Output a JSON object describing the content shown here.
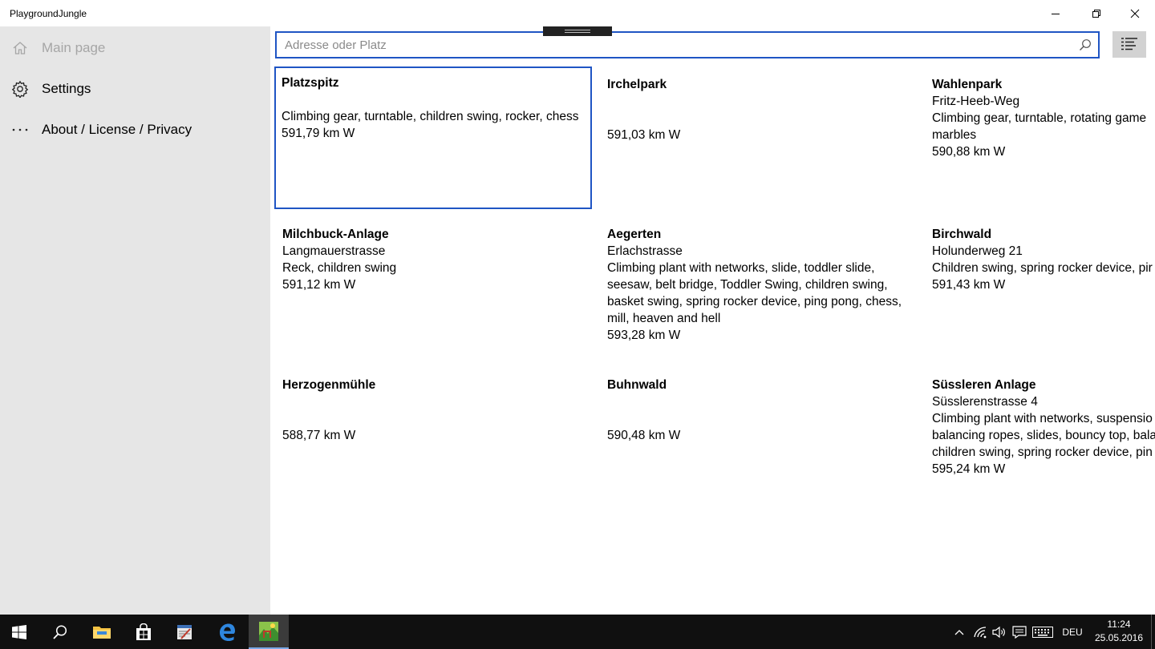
{
  "window": {
    "title": "PlaygroundJungle"
  },
  "nav": {
    "items": [
      {
        "label": "Main page",
        "icon": "home-icon",
        "enabled": false
      },
      {
        "label": "Settings",
        "icon": "gear-icon",
        "enabled": true
      },
      {
        "label": "About / License / Privacy",
        "icon": "more-icon",
        "enabled": true
      }
    ]
  },
  "search": {
    "placeholder": "Adresse oder Platz",
    "value": ""
  },
  "playgrounds": [
    {
      "name": "Platzspitz",
      "address": "",
      "equipment": "Climbing gear, turntable, children swing, rocker, chess",
      "distance": "591,79 km W",
      "selected": true
    },
    {
      "name": "Irchelpark",
      "address": "",
      "equipment": "",
      "distance": "591,03 km W"
    },
    {
      "name": "Wahlenpark",
      "address": "Fritz-Heeb-Weg",
      "equipment": "Climbing gear, turntable, rotating game marbles",
      "distance": "590,88 km W"
    },
    {
      "name": "Milchbuck-Anlage",
      "address": "Langmauerstrasse",
      "equipment": "Reck, children swing",
      "distance": "591,12 km W"
    },
    {
      "name": "Aegerten",
      "address": "Erlachstrasse",
      "equipment": "Climbing plant with networks, slide, toddler slide, seesaw, belt bridge, Toddler Swing, children swing, basket swing, spring rocker device, ping pong, chess, mill, heaven and hell",
      "distance": "593,28 km W"
    },
    {
      "name": "Birchwald",
      "address": "Holunderweg 21",
      "equipment": "Children swing, spring rocker device, pir",
      "distance": "591,43 km W"
    },
    {
      "name": "Herzogenmühle",
      "address": "",
      "equipment": "",
      "distance": "588,77 km W"
    },
    {
      "name": "Buhnwald",
      "address": "",
      "equipment": "",
      "distance": "590,48 km W"
    },
    {
      "name": "Süssleren Anlage",
      "address": "Süsslerenstrasse 4",
      "equipment_lines": [
        "Climbing plant with networks, suspensio",
        "balancing ropes, slides, bouncy top, bala",
        "children swing, spring rocker device, pin"
      ],
      "distance": "595,24 km W"
    }
  ],
  "taskbar": {
    "language": "DEU",
    "time": "11:24",
    "date": "25.05.2016"
  },
  "colors": {
    "accent": "#1f55c4",
    "sidebar": "#e6e6e6",
    "taskbar": "#101010"
  }
}
